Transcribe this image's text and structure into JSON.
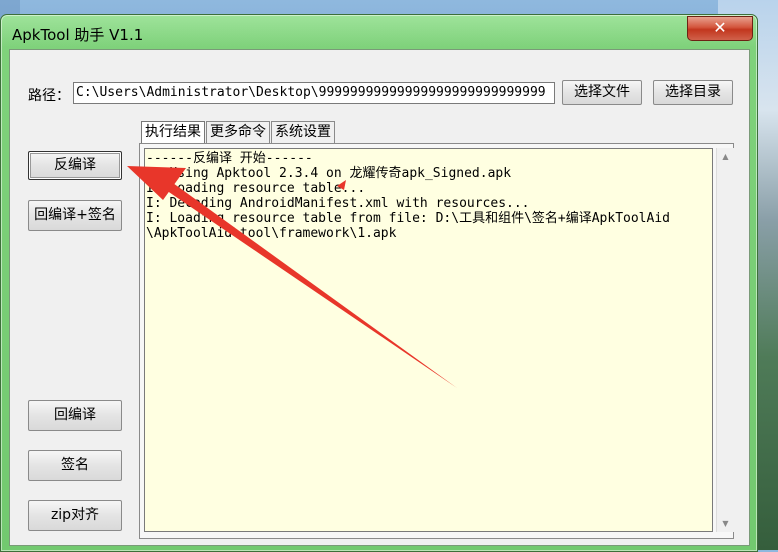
{
  "window": {
    "title": "ApkTool 助手 V1.1",
    "close_glyph": "✕"
  },
  "path": {
    "label": "路径：",
    "value": "C:\\Users\\Administrator\\Desktop\\99999999999999999999999999999"
  },
  "buttons": {
    "choose_file": "选择文件",
    "choose_dir": "选择目录",
    "decompile": "反编译",
    "rebuild_sign": "回编译+签名",
    "rebuild": "回编译",
    "sign": "签名",
    "zip_align": "zip对齐"
  },
  "tabs": [
    {
      "label": "执行结果",
      "active": true
    },
    {
      "label": "更多命令",
      "active": false
    },
    {
      "label": "系统设置",
      "active": false
    }
  ],
  "output": {
    "lines": [
      "------反编译 开始------",
      "I: Using Apktool 2.3.4 on 龙耀传奇apk_Signed.apk",
      "I: Loading resource table...",
      "I: Decoding AndroidManifest.xml with resources...",
      "I: Loading resource table from file: D:\\工具和组件\\签名+编译ApkToolAid",
      "\\ApkToolAid\\tool\\framework\\1.apk"
    ]
  },
  "icons": {
    "scroll_up": "▲",
    "scroll_down": "▼"
  },
  "colors": {
    "annotation_arrow": "#e8362a",
    "output_background": "#ffffe1",
    "title_bar": "#7fd27b",
    "close_button": "#c2361e"
  }
}
